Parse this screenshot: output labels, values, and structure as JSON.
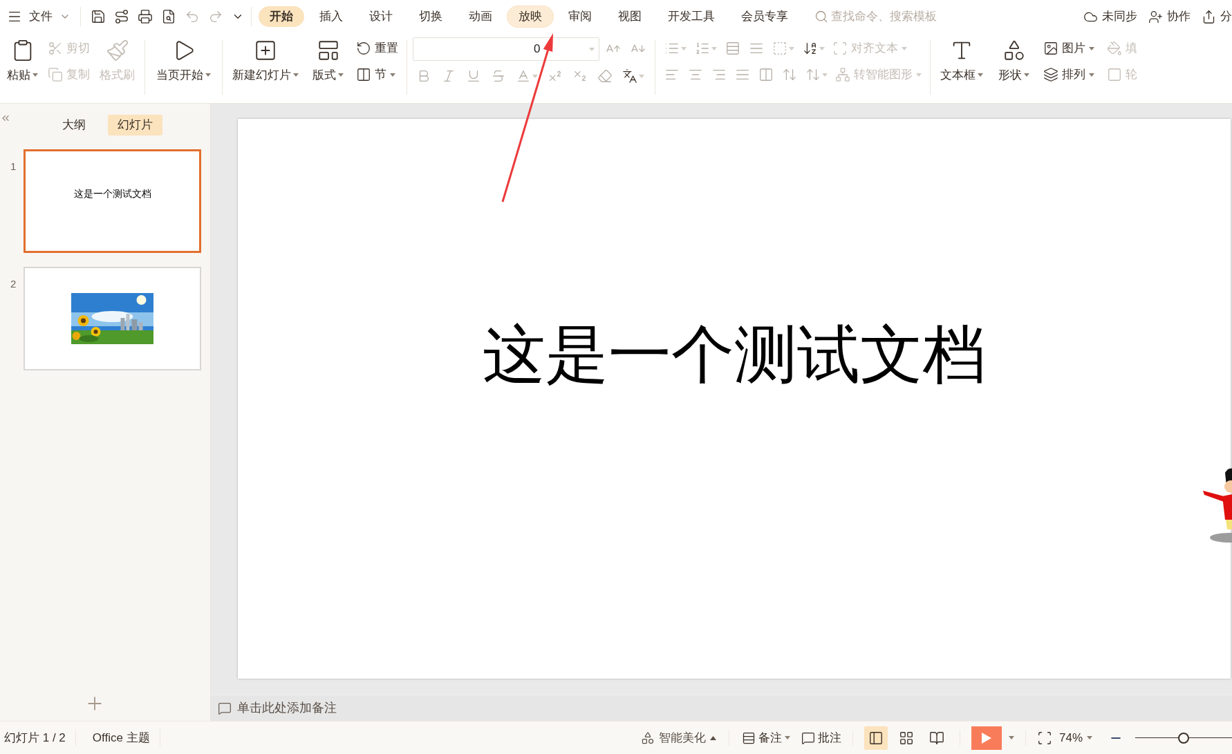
{
  "menu_bar": {
    "file_menu": "文件",
    "tabs": [
      {
        "label": "开始",
        "selected": true,
        "hovered": false
      },
      {
        "label": "插入",
        "selected": false,
        "hovered": false
      },
      {
        "label": "设计",
        "selected": false,
        "hovered": false
      },
      {
        "label": "切换",
        "selected": false,
        "hovered": false
      },
      {
        "label": "动画",
        "selected": false,
        "hovered": false
      },
      {
        "label": "放映",
        "selected": false,
        "hovered": true
      },
      {
        "label": "审阅",
        "selected": false,
        "hovered": false
      },
      {
        "label": "视图",
        "selected": false,
        "hovered": false
      },
      {
        "label": "开发工具",
        "selected": false,
        "hovered": false
      },
      {
        "label": "会员专享",
        "selected": false,
        "hovered": false
      }
    ],
    "search": {
      "placeholder": "查找命令、搜索模板"
    },
    "actions": [
      "未同步",
      "协作",
      "分"
    ]
  },
  "ribbon": {
    "clipboard": [
      {
        "label": "粘贴",
        "disabled": false,
        "dropdown": true
      },
      {
        "label": "剪切",
        "disabled": true,
        "dropdown": false
      },
      {
        "label": "复制",
        "disabled": true,
        "dropdown": false
      },
      {
        "label": "格式刷",
        "disabled": true,
        "dropdown": false
      }
    ],
    "slideshow": [
      {
        "label": "当页开始",
        "disabled": false,
        "dropdown": true
      }
    ],
    "slides": [
      {
        "label": "新建幻灯片",
        "disabled": false,
        "dropdown": true
      },
      {
        "label": "版式",
        "disabled": false,
        "dropdown": true
      },
      {
        "label": "重置",
        "disabled": false,
        "dropdown": false
      },
      {
        "label": "节",
        "disabled": false,
        "dropdown": true
      }
    ],
    "font": {
      "font_size": "0"
    },
    "paragraph": [
      {
        "label": "对齐文本",
        "disabled": true,
        "dropdown": true
      },
      {
        "label": "转智能图形",
        "disabled": true,
        "dropdown": true
      }
    ],
    "insert": [
      {
        "label": "文本框",
        "disabled": false,
        "dropdown": true
      },
      {
        "label": "形状",
        "disabled": false,
        "dropdown": true
      },
      {
        "label": "图片",
        "disabled": false,
        "dropdown": true
      },
      {
        "label": "排列",
        "disabled": false,
        "dropdown": true
      },
      {
        "label": "填",
        "disabled": true,
        "dropdown": false
      },
      {
        "label": "轮",
        "disabled": true,
        "dropdown": false
      }
    ]
  },
  "side_panel": {
    "tabs": [
      {
        "label": "大纲",
        "selected": false
      },
      {
        "label": "幻灯片",
        "selected": true
      }
    ],
    "thumbnails": [
      {
        "number": "1",
        "selected": true,
        "kind": "text",
        "text": "这是一个测试文档"
      },
      {
        "number": "2",
        "selected": false,
        "kind": "picture"
      }
    ]
  },
  "slide": {
    "title": "这是一个测试文档"
  },
  "notes": {
    "prompt": "单击此处添加备注"
  },
  "status_bar": {
    "slide_info": "幻灯片 1 / 2",
    "theme": "Office 主题",
    "beautify": "智能美化",
    "notes_button": "备注",
    "comments_button": "批注",
    "views": [
      {
        "selected": true
      },
      {
        "selected": false
      },
      {
        "selected": false
      }
    ],
    "zoom": "74%",
    "zoom_slider": {
      "level": 0.5
    }
  }
}
